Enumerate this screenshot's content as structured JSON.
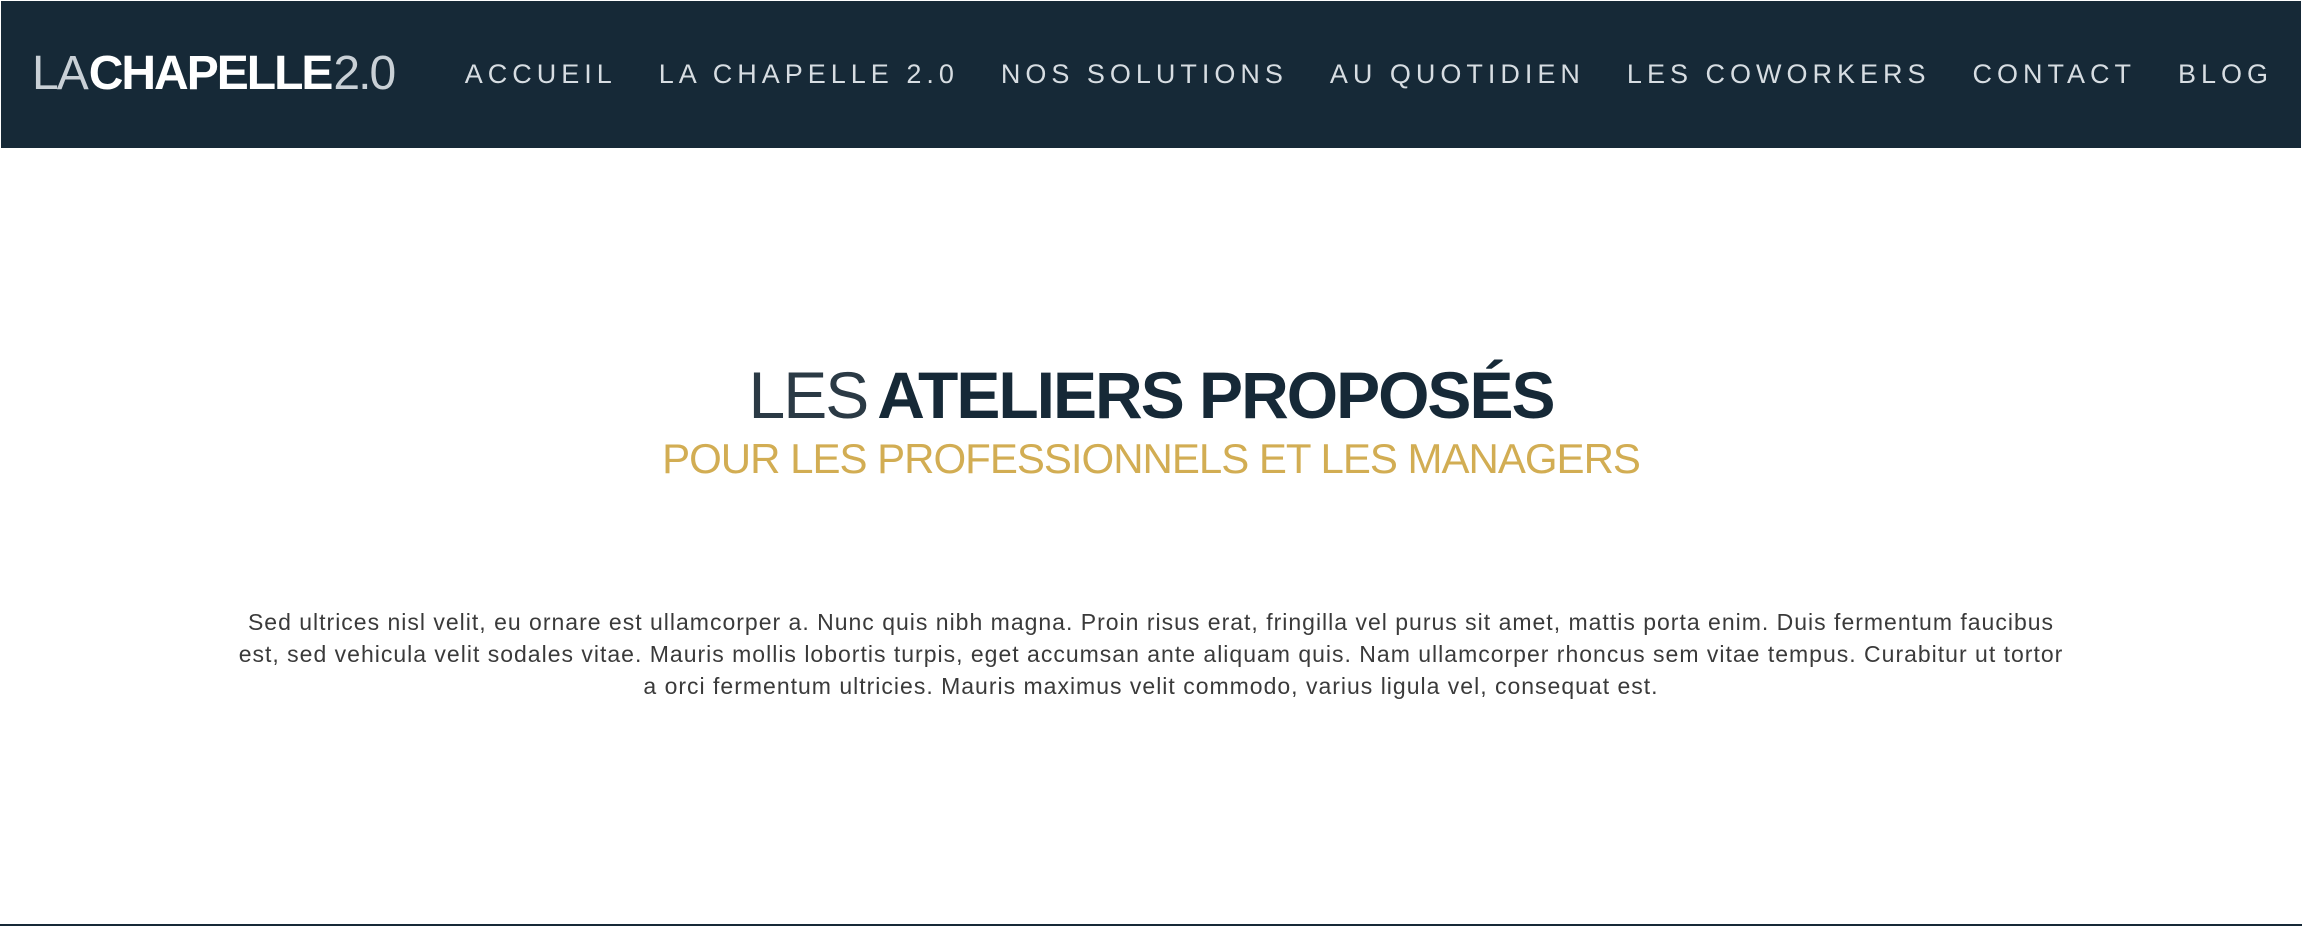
{
  "header": {
    "logo": {
      "thin": "LA",
      "bold": "CHAPELLE",
      "version": "2.0"
    },
    "nav": [
      "ACCUEIL",
      "LA CHAPELLE 2.0",
      "NOS SOLUTIONS",
      "AU QUOTIDIEN",
      "LES COWORKERS",
      "CONTACT",
      "BLOG"
    ],
    "colors": {
      "background": "#162937",
      "text": "#d7dde2"
    }
  },
  "hero": {
    "title": {
      "thin": "LES",
      "bold": "ATELIERS PROPOSÉS"
    },
    "subtitle": "POUR LES PROFESSIONNELS ET LES MANAGERS",
    "body": "Sed ultrices nisl velit, eu ornare est ullamcorper a. Nunc quis nibh magna. Proin risus erat, fringilla vel purus sit amet, mattis porta enim. Duis fermentum faucibus est, sed vehicula velit sodales vitae. Mauris mollis lobortis turpis, eget accumsan ante aliquam quis. Nam ullamcorper rhoncus sem vitae tempus. Curabitur ut tortor a orci fermentum ultricies. Mauris maximus velit commodo, varius ligula vel, consequat est.",
    "colors": {
      "title": "#162937",
      "subtitle": "#d2ad53",
      "body": "#3a3a3a"
    }
  }
}
